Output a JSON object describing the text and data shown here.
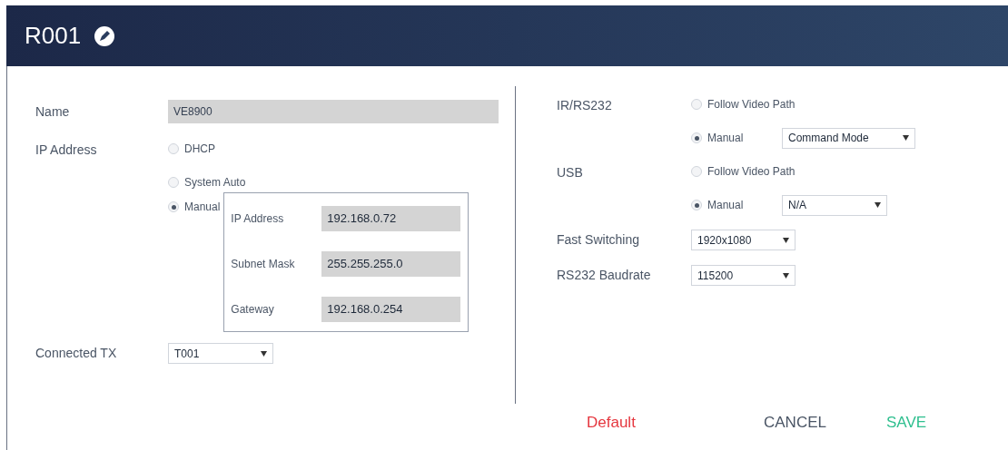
{
  "title": "R001",
  "left": {
    "name": {
      "label": "Name",
      "value": "VE8900"
    },
    "ip_address": {
      "label": "IP Address",
      "options": [
        {
          "label": "DHCP",
          "selected": false
        },
        {
          "label": "System Auto",
          "selected": false
        },
        {
          "label": "Manual",
          "selected": true
        }
      ],
      "manual_fields": [
        {
          "label": "IP Address",
          "value": "192.168.0.72"
        },
        {
          "label": "Subnet Mask",
          "value": "255.255.255.0"
        },
        {
          "label": "Gateway",
          "value": "192.168.0.254"
        }
      ]
    },
    "connected_tx": {
      "label": "Connected TX",
      "value": "T001"
    }
  },
  "right": {
    "ir_rs232": {
      "label": "IR/RS232",
      "options": [
        {
          "label": "Follow Video Path",
          "selected": false
        },
        {
          "label": "Manual",
          "selected": true,
          "dropdown": "Command Mode"
        }
      ]
    },
    "usb": {
      "label": "USB",
      "options": [
        {
          "label": "Follow Video Path",
          "selected": false
        },
        {
          "label": "Manual",
          "selected": true,
          "dropdown": "N/A"
        }
      ]
    },
    "fast_switching": {
      "label": "Fast Switching",
      "value": "1920x1080"
    },
    "rs232_baudrate": {
      "label": "RS232 Baudrate",
      "value": "115200"
    }
  },
  "buttons": [
    {
      "label": "Default",
      "kind": "reset"
    },
    {
      "label": "CANCEL",
      "kind": "cancel"
    },
    {
      "label": "SAVE",
      "kind": "save"
    }
  ]
}
